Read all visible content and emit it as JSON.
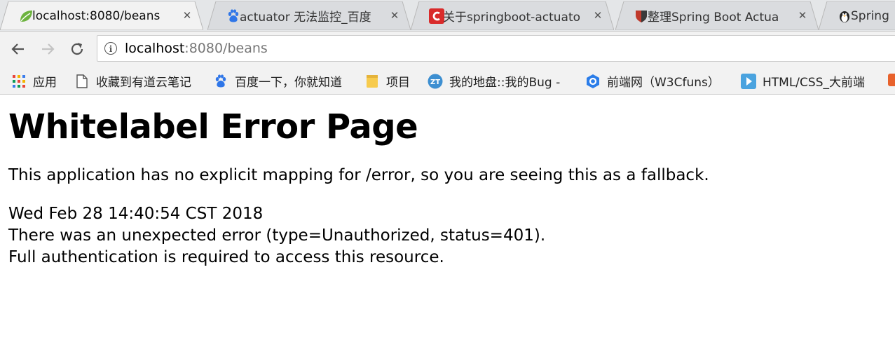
{
  "browser": {
    "tabs": [
      {
        "title": "localhost:8080/beans",
        "icon": "spring-leaf-icon",
        "active": true
      },
      {
        "title": "actuator 无法监控_百度",
        "icon": "baidu-paw-icon",
        "active": false
      },
      {
        "title": "关于springboot-actuato",
        "icon": "csdn-icon",
        "active": false
      },
      {
        "title": "整理Spring Boot Actua",
        "icon": "shield-icon",
        "active": false
      },
      {
        "title": "Spring",
        "icon": "penguin-icon",
        "active": false
      }
    ],
    "close_glyph": "✕",
    "address": {
      "host": "localhost",
      "rest": ":8080/beans"
    },
    "bookmarks": [
      {
        "label": "应用",
        "icon": "apps-grid-icon"
      },
      {
        "label": "收藏到有道云笔记",
        "icon": "page-icon"
      },
      {
        "label": "百度一下，你就知道",
        "icon": "baidu-paw-icon"
      },
      {
        "label": "项目",
        "icon": "folder-icon"
      },
      {
        "label": "我的地盘::我的Bug -",
        "icon": "zt-icon",
        "icon_text": "ZT"
      },
      {
        "label": "前端网（W3Cfuns）",
        "icon": "hexagon-icon"
      },
      {
        "label": "HTML/CSS_大前端",
        "icon": "play-icon"
      },
      {
        "label": "",
        "icon": "orange-icon"
      }
    ]
  },
  "page": {
    "heading": "Whitelabel Error Page",
    "message": "This application has no explicit mapping for /error, so you are seeing this as a fallback.",
    "timestamp": "Wed Feb 28 14:40:54 CST 2018",
    "error_line": "There was an unexpected error (type=Unauthorized, status=401).",
    "detail_line": "Full authentication is required to access this resource."
  },
  "colors": {
    "tab_active_bg": "#f2f2f2",
    "tab_inactive_bg": "#dadcdf",
    "tabstrip_bg": "#e4e6e8",
    "spring_green": "#6db33f",
    "baidu_blue": "#2f76e8",
    "csdn_red": "#d92b2b"
  }
}
